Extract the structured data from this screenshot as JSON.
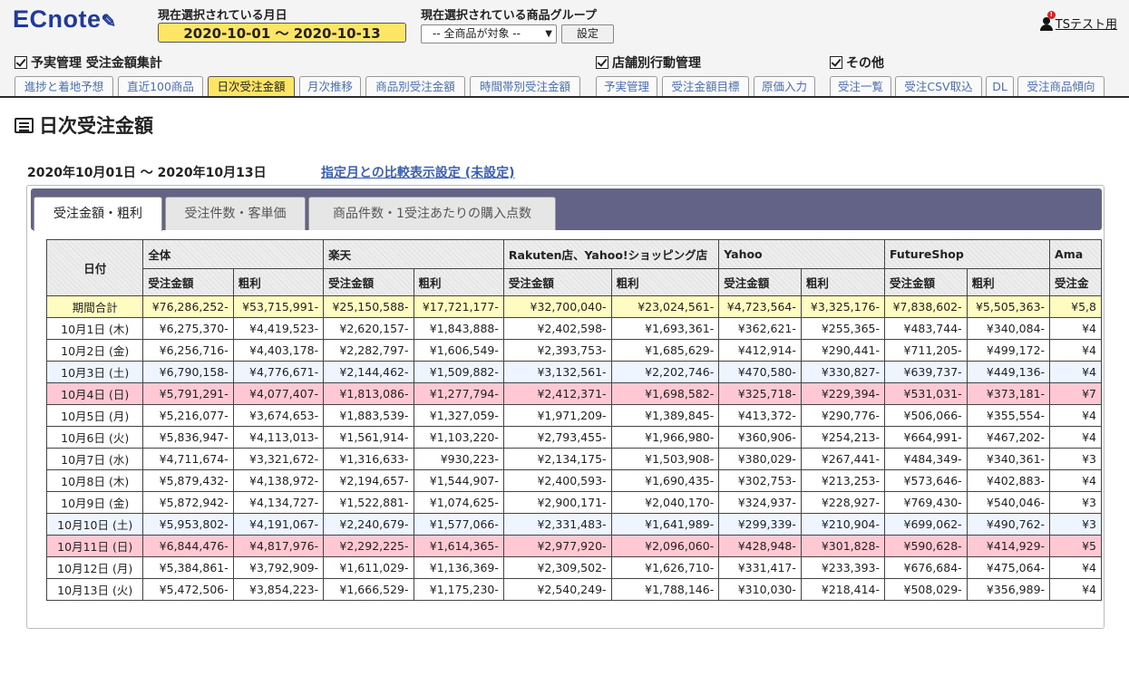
{
  "header": {
    "logo": "ECnote",
    "period_label": "現在選択されている月日",
    "period_value": "2020-10-01 〜 2020-10-13",
    "group_label": "現在選択されている商品グループ",
    "group_select_value": "-- 全商品が対象 --",
    "set_button": "設定",
    "user_name": "TSテスト用",
    "user_badge": "!"
  },
  "sections": [
    {
      "label": "予実管理 受注金額集計"
    },
    {
      "label": "店舗別行動管理"
    },
    {
      "label": "その他"
    }
  ],
  "nav_tabs": [
    {
      "label": "進捗と着地予想"
    },
    {
      "label": "直近100商品"
    },
    {
      "label": "日次受注金額"
    },
    {
      "label": "月次推移"
    },
    {
      "label": "商品別受注金額"
    },
    {
      "label": "時間帯別受注金額"
    },
    {
      "label": "予実管理"
    },
    {
      "label": "受注金額目標"
    },
    {
      "label": "原価入力"
    },
    {
      "label": "受注一覧"
    },
    {
      "label": "受注CSV取込"
    },
    {
      "label": "DL"
    },
    {
      "label": "受注商品傾向"
    }
  ],
  "page": {
    "title": "日次受注金額",
    "range": "2020年10月01日 〜 2020年10月13日",
    "compare_link": "指定月との比較表示設定 (未設定)"
  },
  "panel_tabs": [
    {
      "label": "受注金額・粗利"
    },
    {
      "label": "受注件数・客単価"
    },
    {
      "label": "商品件数・1受注あたりの購入点数"
    }
  ],
  "table": {
    "date_header": "日付",
    "groups": [
      {
        "name": "全体",
        "cols": [
          "受注金額",
          "粗利"
        ]
      },
      {
        "name": "楽天",
        "cols": [
          "受注金額",
          "粗利"
        ]
      },
      {
        "name": "Rakuten店、Yahoo!ショッピング店",
        "cols": [
          "受注金額",
          "粗利"
        ]
      },
      {
        "name": "Yahoo",
        "cols": [
          "受注金額",
          "粗利"
        ]
      },
      {
        "name": "FutureShop",
        "cols": [
          "受注金額",
          "粗利"
        ]
      },
      {
        "name": "Ama",
        "cols": [
          "受注金"
        ]
      }
    ],
    "rows": [
      {
        "date": "期間合計",
        "kind": "total",
        "values": [
          "¥76,286,252-",
          "¥53,715,991-",
          "¥25,150,588-",
          "¥17,721,177-",
          "¥32,700,040-",
          "¥23,024,561-",
          "¥4,723,564-",
          "¥3,325,176-",
          "¥7,838,602-",
          "¥5,505,363-",
          "¥5,8"
        ]
      },
      {
        "date": "10月1日 (木)",
        "kind": "weekday",
        "values": [
          "¥6,275,370-",
          "¥4,419,523-",
          "¥2,620,157-",
          "¥1,843,888-",
          "¥2,402,598-",
          "¥1,693,361-",
          "¥362,621-",
          "¥255,365-",
          "¥483,744-",
          "¥340,084-",
          "¥4"
        ]
      },
      {
        "date": "10月2日 (金)",
        "kind": "weekday",
        "values": [
          "¥6,256,716-",
          "¥4,403,178-",
          "¥2,282,797-",
          "¥1,606,549-",
          "¥2,393,753-",
          "¥1,685,629-",
          "¥412,914-",
          "¥290,441-",
          "¥711,205-",
          "¥499,172-",
          "¥4"
        ]
      },
      {
        "date": "10月3日 (土)",
        "kind": "sat",
        "values": [
          "¥6,790,158-",
          "¥4,776,671-",
          "¥2,144,462-",
          "¥1,509,882-",
          "¥3,132,561-",
          "¥2,202,746-",
          "¥470,580-",
          "¥330,827-",
          "¥639,737-",
          "¥449,136-",
          "¥4"
        ]
      },
      {
        "date": "10月4日 (日)",
        "kind": "sun",
        "values": [
          "¥5,791,291-",
          "¥4,077,407-",
          "¥1,813,086-",
          "¥1,277,794-",
          "¥2,412,371-",
          "¥1,698,582-",
          "¥325,718-",
          "¥229,394-",
          "¥531,031-",
          "¥373,181-",
          "¥7"
        ]
      },
      {
        "date": "10月5日 (月)",
        "kind": "weekday",
        "values": [
          "¥5,216,077-",
          "¥3,674,653-",
          "¥1,883,539-",
          "¥1,327,059-",
          "¥1,971,209-",
          "¥1,389,845-",
          "¥413,372-",
          "¥290,776-",
          "¥506,066-",
          "¥355,554-",
          "¥4"
        ]
      },
      {
        "date": "10月6日 (火)",
        "kind": "weekday",
        "values": [
          "¥5,836,947-",
          "¥4,113,013-",
          "¥1,561,914-",
          "¥1,103,220-",
          "¥2,793,455-",
          "¥1,966,980-",
          "¥360,906-",
          "¥254,213-",
          "¥664,991-",
          "¥467,202-",
          "¥4"
        ]
      },
      {
        "date": "10月7日 (水)",
        "kind": "weekday",
        "values": [
          "¥4,711,674-",
          "¥3,321,672-",
          "¥1,316,633-",
          "¥930,223-",
          "¥2,134,175-",
          "¥1,503,908-",
          "¥380,029-",
          "¥267,441-",
          "¥484,349-",
          "¥340,361-",
          "¥3"
        ]
      },
      {
        "date": "10月8日 (木)",
        "kind": "weekday",
        "values": [
          "¥5,879,432-",
          "¥4,138,972-",
          "¥2,194,657-",
          "¥1,544,907-",
          "¥2,400,593-",
          "¥1,690,435-",
          "¥302,753-",
          "¥213,253-",
          "¥573,646-",
          "¥402,883-",
          "¥4"
        ]
      },
      {
        "date": "10月9日 (金)",
        "kind": "weekday",
        "values": [
          "¥5,872,942-",
          "¥4,134,727-",
          "¥1,522,881-",
          "¥1,074,625-",
          "¥2,900,171-",
          "¥2,040,170-",
          "¥324,937-",
          "¥228,927-",
          "¥769,430-",
          "¥540,046-",
          "¥3"
        ]
      },
      {
        "date": "10月10日 (土)",
        "kind": "sat",
        "values": [
          "¥5,953,802-",
          "¥4,191,067-",
          "¥2,240,679-",
          "¥1,577,066-",
          "¥2,331,483-",
          "¥1,641,989-",
          "¥299,339-",
          "¥210,904-",
          "¥699,062-",
          "¥490,762-",
          "¥3"
        ]
      },
      {
        "date": "10月11日 (日)",
        "kind": "sun",
        "values": [
          "¥6,844,476-",
          "¥4,817,976-",
          "¥2,292,225-",
          "¥1,614,365-",
          "¥2,977,920-",
          "¥2,096,060-",
          "¥428,948-",
          "¥301,828-",
          "¥590,628-",
          "¥414,929-",
          "¥5"
        ]
      },
      {
        "date": "10月12日 (月)",
        "kind": "weekday",
        "values": [
          "¥5,384,861-",
          "¥3,792,909-",
          "¥1,611,029-",
          "¥1,136,369-",
          "¥2,309,502-",
          "¥1,626,710-",
          "¥331,417-",
          "¥233,393-",
          "¥676,684-",
          "¥475,064-",
          "¥4"
        ]
      },
      {
        "date": "10月13日 (火)",
        "kind": "weekday",
        "values": [
          "¥5,472,506-",
          "¥3,854,223-",
          "¥1,666,529-",
          "¥1,175,230-",
          "¥2,540,249-",
          "¥1,788,146-",
          "¥310,030-",
          "¥218,414-",
          "¥508,029-",
          "¥356,989-",
          "¥4"
        ]
      }
    ]
  }
}
